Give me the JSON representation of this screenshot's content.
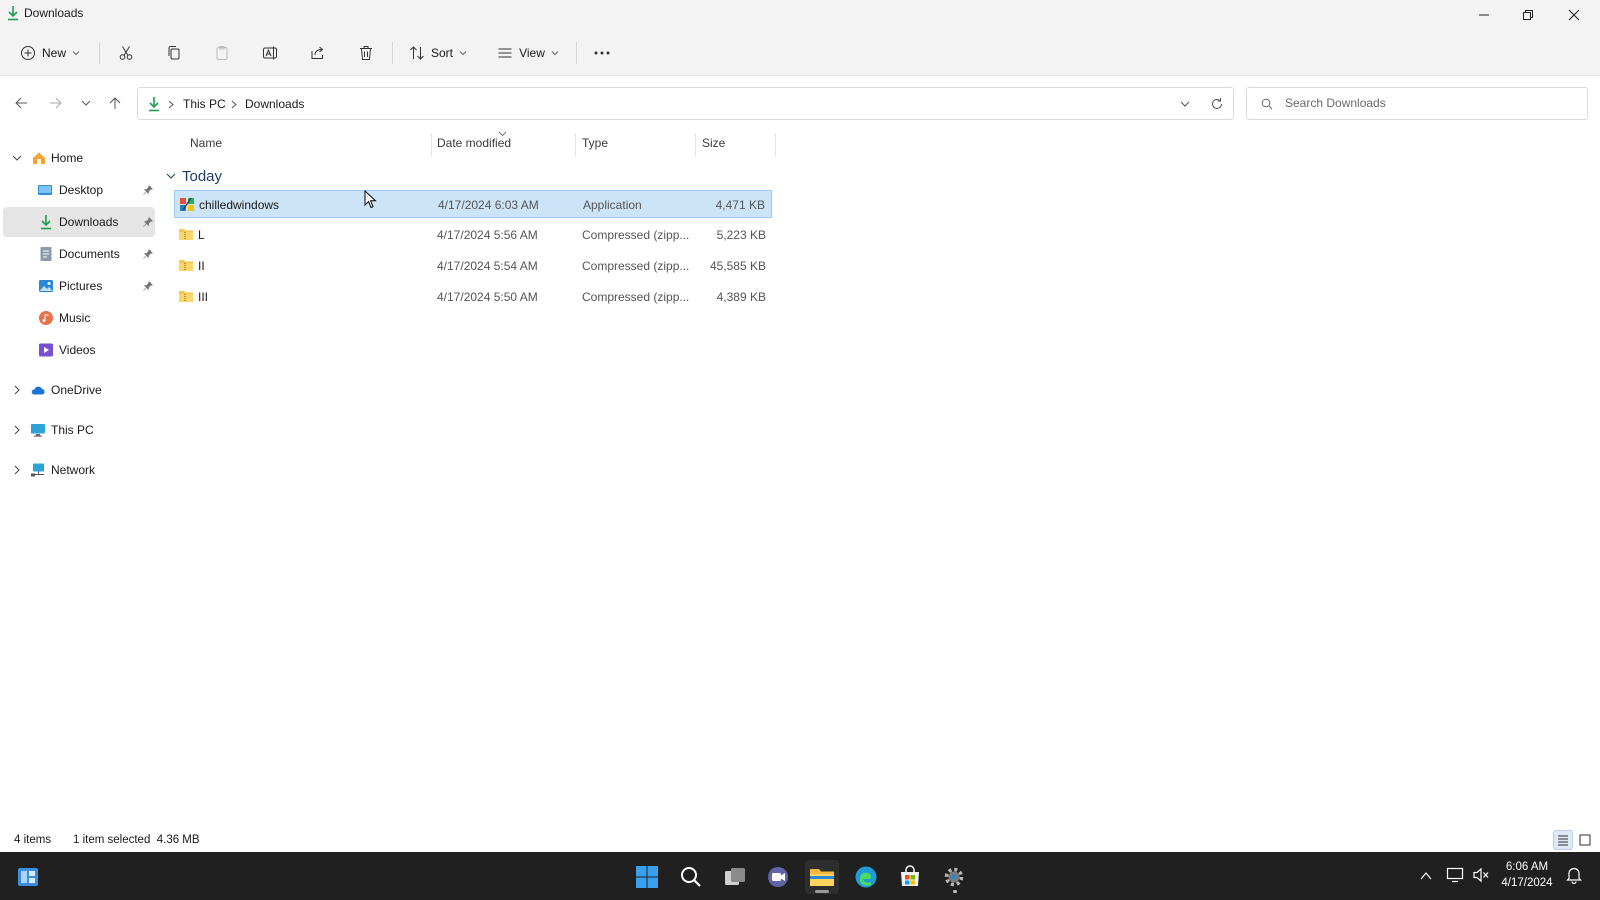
{
  "window": {
    "title": "Downloads"
  },
  "toolbar": {
    "new_label": "New",
    "sort_label": "Sort",
    "view_label": "View"
  },
  "address": {
    "crumbs": [
      "This PC",
      "Downloads"
    ]
  },
  "search": {
    "placeholder": "Search Downloads"
  },
  "nav": {
    "items": [
      {
        "label": "Home",
        "icon": "home-icon",
        "pinned": false,
        "expanded": true
      },
      {
        "label": "Desktop",
        "icon": "desktop-icon",
        "pinned": true
      },
      {
        "label": "Downloads",
        "icon": "download-icon",
        "pinned": true,
        "selected": true
      },
      {
        "label": "Documents",
        "icon": "document-icon",
        "pinned": true
      },
      {
        "label": "Pictures",
        "icon": "pictures-icon",
        "pinned": true
      },
      {
        "label": "Music",
        "icon": "music-icon",
        "pinned": false
      },
      {
        "label": "Videos",
        "icon": "videos-icon",
        "pinned": false
      },
      {
        "label": "OneDrive",
        "icon": "cloud-icon",
        "expanded": false
      },
      {
        "label": "This PC",
        "icon": "computer-icon",
        "expanded": false
      },
      {
        "label": "Network",
        "icon": "network-icon",
        "expanded": false
      }
    ]
  },
  "columns": {
    "name": "Name",
    "date": "Date modified",
    "type": "Type",
    "size": "Size"
  },
  "group": {
    "label": "Today"
  },
  "files": [
    {
      "name": "chilledwindows",
      "date": "4/17/2024 6:03 AM",
      "type": "Application",
      "size": "4,471 KB",
      "icon": "application-icon",
      "selected": true
    },
    {
      "name": "L",
      "date": "4/17/2024 5:56 AM",
      "type": "Compressed (zipp...",
      "size": "5,223 KB",
      "icon": "zip-folder-icon"
    },
    {
      "name": "II",
      "date": "4/17/2024 5:54 AM",
      "type": "Compressed (zipp...",
      "size": "45,585 KB",
      "icon": "zip-folder-icon"
    },
    {
      "name": "III",
      "date": "4/17/2024 5:50 AM",
      "type": "Compressed (zipp...",
      "size": "4,389 KB",
      "icon": "zip-folder-icon"
    }
  ],
  "status": {
    "count": "4 items",
    "selection": "1 item selected  4.36 MB"
  },
  "clock": {
    "time": "6:06 AM",
    "date": "4/17/2024"
  },
  "colors": {
    "selection_bg": "#cce4f7",
    "accent": "#0067c0",
    "taskbar": "#202020"
  }
}
